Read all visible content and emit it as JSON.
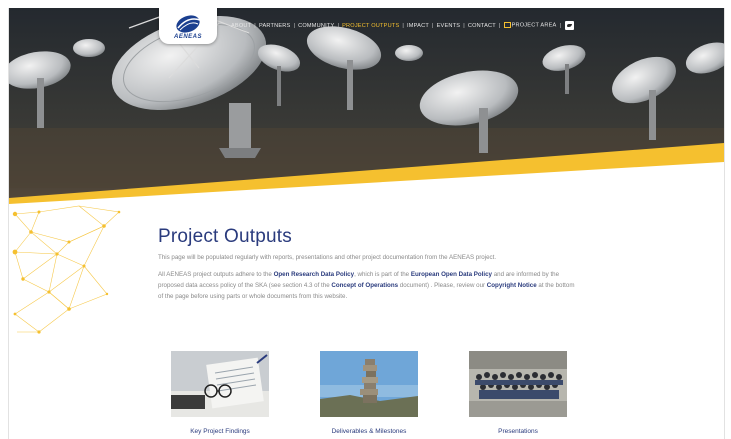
{
  "logo": {
    "text": "AENEAS"
  },
  "nav": {
    "items": [
      "ABOUT",
      "PARTNERS",
      "COMMUNITY",
      "PROJECT OUTPUTS",
      "IMPACT",
      "EVENTS",
      "CONTACT",
      "PROJECT AREA"
    ],
    "active": "PROJECT OUTPUTS",
    "social_icon": "twitter-icon"
  },
  "page": {
    "title": "Project Outputs",
    "intro": "This page will be populated regularly with reports, presentations and other project documentation from the AENEAS project.",
    "p2_a": "All AENEAS project outputs adhere to the ",
    "p2_link1": "Open Research Data Policy",
    "p2_b": ", which is part of the ",
    "p2_link2": "European Open Data Policy",
    "p2_c": " and are informed by the proposed data access policy of the SKA (see section 4.3 of the ",
    "p2_link3": "Concept of Operations",
    "p2_d": " document) . Please, review our ",
    "p2_link4": "Copyright Notice",
    "p2_e": " at the bottom of the page before using parts or whole documents from this website."
  },
  "cards": [
    {
      "label": "Key Project Findings"
    },
    {
      "label": "Deliverables & Milestones"
    },
    {
      "label": "Presentations"
    }
  ],
  "colors": {
    "accent": "#f5c02f",
    "brand": "#2a3b7d",
    "nav_text": "#e6e6e6"
  }
}
